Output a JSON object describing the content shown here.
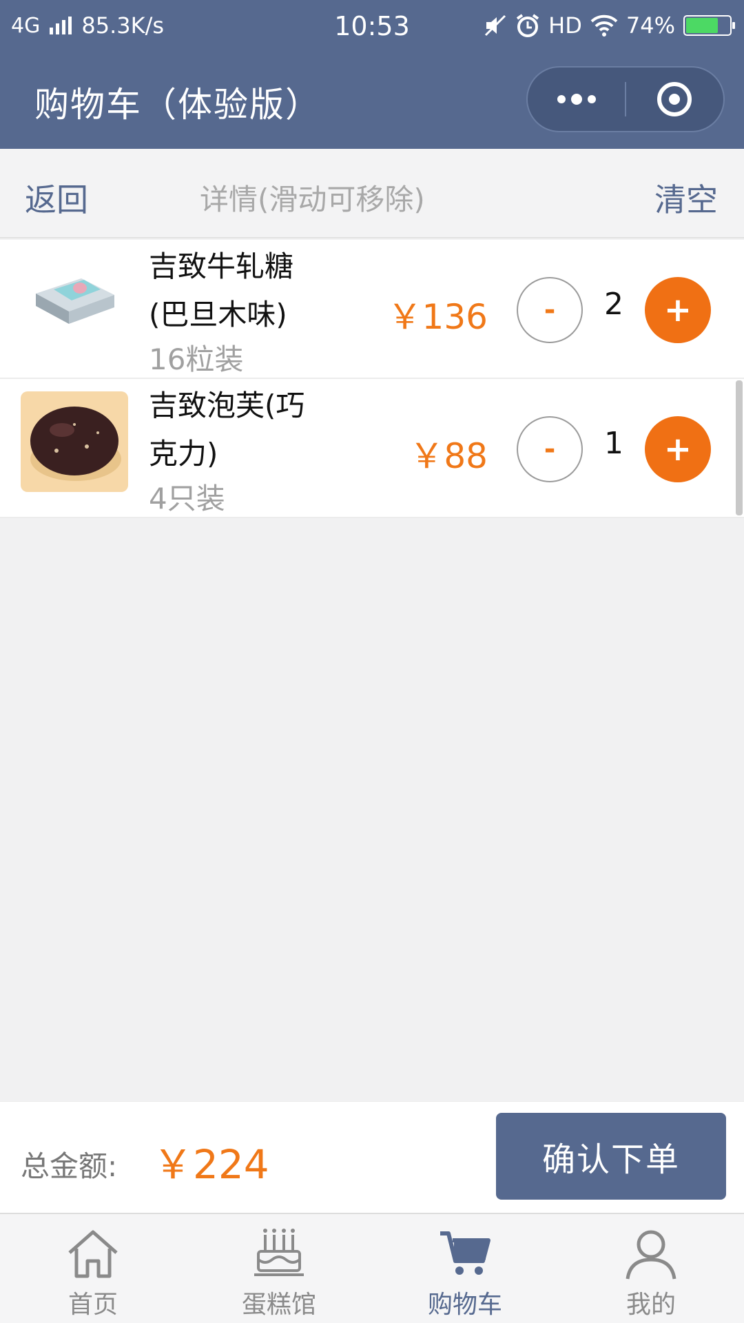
{
  "status_bar": {
    "network": "4G",
    "speed": "85.3K/s",
    "time": "10:53",
    "hd": "HD",
    "battery": "74%",
    "battery_level": 0.74
  },
  "nav": {
    "title": "购物车（体验版）",
    "more_icon": "more-dots-icon",
    "close_icon": "target-close-icon"
  },
  "subheader": {
    "back": "返回",
    "hint": "详情(滑动可移除)",
    "clear": "清空"
  },
  "items": [
    {
      "name": "吉致牛轧糖(巴旦木味)",
      "spec": "16粒装",
      "price": "￥136",
      "quantity": "2",
      "minus": "-",
      "plus": "+"
    },
    {
      "name": "吉致泡芙(巧克力)",
      "spec": "4只装",
      "price": "￥88",
      "quantity": "1",
      "minus": "-",
      "plus": "+"
    }
  ],
  "footer": {
    "total_label": "总金额:",
    "total_amount": "￥224",
    "confirm": "确认下单"
  },
  "tabs": [
    {
      "label": "首页",
      "icon": "home-icon",
      "active": false
    },
    {
      "label": "蛋糕馆",
      "icon": "cake-icon",
      "active": false
    },
    {
      "label": "购物车",
      "icon": "cart-icon",
      "active": true
    },
    {
      "label": "我的",
      "icon": "user-icon",
      "active": false
    }
  ],
  "colors": {
    "primary": "#56698f",
    "accent": "#f07818",
    "background": "#f1f1f2"
  }
}
